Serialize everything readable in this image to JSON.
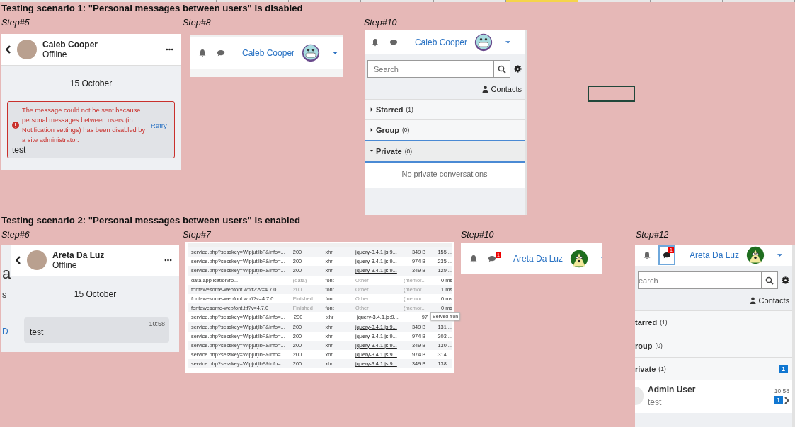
{
  "scenarios": [
    {
      "title": "Testing scenario 1: \"Personal messages between users\" is disabled",
      "steps": [
        {
          "label": "Step#5",
          "kind": "chat",
          "user": {
            "name": "Caleb Cooper",
            "status": "Offline"
          },
          "date": "15 October",
          "error": {
            "text": "The message could not be sent because personal messages between users (in Notification settings) has been disabled by a site administrator.",
            "retry": "Retry"
          },
          "message": {
            "text": "test"
          }
        },
        {
          "label": "Step#8",
          "kind": "navbar",
          "user": {
            "name": "Caleb Cooper",
            "avatar": {
              "kind": "grin"
            }
          },
          "focused": false
        },
        {
          "label": "Step#10",
          "kind": "drawer",
          "user": {
            "name": "Caleb Cooper",
            "avatar": {
              "kind": "grin"
            }
          },
          "focused": false,
          "search": {
            "placeholder": "Search"
          },
          "contacts": "Contacts",
          "sections": [
            {
              "name": "Starred",
              "count": "(1)",
              "expanded": false
            },
            {
              "name": "Group",
              "count": "(0)",
              "expanded": false
            },
            {
              "name": "Private",
              "count": "(0)",
              "expanded": true
            }
          ],
          "empty": "No private conversations"
        }
      ]
    },
    {
      "title": "Testing scenario 2: \"Personal messages between users\" is enabled",
      "steps": [
        {
          "label": "Step#6",
          "kind": "chat",
          "user": {
            "name": "Areta Da Luz",
            "status": "Offline"
          },
          "date": "15 October",
          "message": {
            "text": "test",
            "time": "10:58"
          },
          "fragments": [
            "a",
            "s",
            "D"
          ]
        },
        {
          "label": "Step#7",
          "kind": "network",
          "rows": [
            {
              "kind": "xhr",
              "name": "service.php?sesskey=WlpjutjlbF&info=...",
              "status": "200",
              "type": "xhr",
              "initiator": "jquery-3.4.1.js:9...",
              "size": "349 B",
              "time": "155 ..."
            },
            {
              "kind": "xhr",
              "name": "service.php?sesskey=WlpjutjlbF&info=...",
              "status": "200",
              "type": "xhr",
              "initiator": "jquery-3.4.1.js:9...",
              "size": "974 B",
              "time": "235 ..."
            },
            {
              "kind": "xhr",
              "name": "service.php?sesskey=WlpjutjlbF&info=...",
              "status": "200",
              "type": "xhr",
              "initiator": "jquery-3.4.1.js:9...",
              "size": "349 B",
              "time": "129 ..."
            },
            {
              "kind": "cached",
              "name": "data:application/fo...",
              "status": "(data)",
              "type": "font",
              "initiator": "Other",
              "size": "(memor...",
              "time": "0 ms"
            },
            {
              "kind": "cached",
              "name": "fontawesome-webfont.woff2?v=4.7.0",
              "status": "200",
              "type": "font",
              "initiator": "Other",
              "size": "(memor...",
              "time": "1 ms"
            },
            {
              "kind": "cached",
              "name": "fontawesome-webfont.woff?v=4.7.0",
              "status": "Finished",
              "type": "font",
              "initiator": "Other",
              "size": "(memor...",
              "time": "0 ms"
            },
            {
              "kind": "cached",
              "name": "fontawesome-webfont.ttf?v=4.7.0",
              "status": "Finished",
              "type": "font",
              "initiator": "Other",
              "size": "(memor...",
              "time": "0 ms"
            },
            {
              "kind": "xhr",
              "name": "service.php?sesskey=WlpjutjlbF&info=...",
              "status": "200",
              "type": "xhr",
              "initiator": "jquery-3.4.1.js:9...",
              "size": "97",
              "tooltip": "Served fron"
            },
            {
              "kind": "xhr",
              "name": "service.php?sesskey=WlpjutjlbF&info=...",
              "status": "200",
              "type": "xhr",
              "initiator": "jquery-3.4.1.js:9...",
              "size": "349 B",
              "time": "131 ..."
            },
            {
              "kind": "xhr",
              "name": "service.php?sesskey=WlpjutjlbF&info=...",
              "status": "200",
              "type": "xhr",
              "initiator": "jquery-3.4.1.js:9...",
              "size": "974 B",
              "time": "303 ..."
            },
            {
              "kind": "xhr",
              "name": "service.php?sesskey=WlpjutjlbF&info=...",
              "status": "200",
              "type": "xhr",
              "initiator": "jquery-3.4.1.js:9...",
              "size": "349 B",
              "time": "130 ..."
            },
            {
              "kind": "xhr",
              "name": "service.php?sesskey=WlpjutjlbF&info=...",
              "status": "200",
              "type": "xhr",
              "initiator": "jquery-3.4.1.js:9...",
              "size": "974 B",
              "time": "314 ..."
            },
            {
              "kind": "xhr",
              "name": "service.php?sesskey=WlpjutjlbF&info=...",
              "status": "200",
              "type": "xhr",
              "initiator": "jquery-3.4.1.js:9...",
              "size": "349 B",
              "time": "138 ..."
            }
          ]
        },
        {
          "label": "Step#10",
          "kind": "navbar",
          "user": {
            "name": "Areta Da Luz",
            "avatar": {
              "kind": "green"
            }
          },
          "unread": "1",
          "focused": false
        },
        {
          "label": "Step#12",
          "kind": "drawer",
          "user": {
            "name": "Areta Da Luz",
            "avatar": {
              "kind": "green"
            }
          },
          "unread": "1",
          "focused": true,
          "search": {
            "placeholder": "earch"
          },
          "contacts": "Contacts",
          "sections": [
            {
              "name": "tarred",
              "count": "(1)",
              "expanded": false
            },
            {
              "name": "roup",
              "count": "(0)",
              "expanded": false
            },
            {
              "name": "rivate",
              "count": "(1)",
              "expanded": false,
              "badge": "1"
            }
          ],
          "conversations": [
            {
              "name": "Admin User",
              "preview": "test",
              "time": "10:58",
              "unread": "1"
            }
          ]
        }
      ]
    }
  ]
}
